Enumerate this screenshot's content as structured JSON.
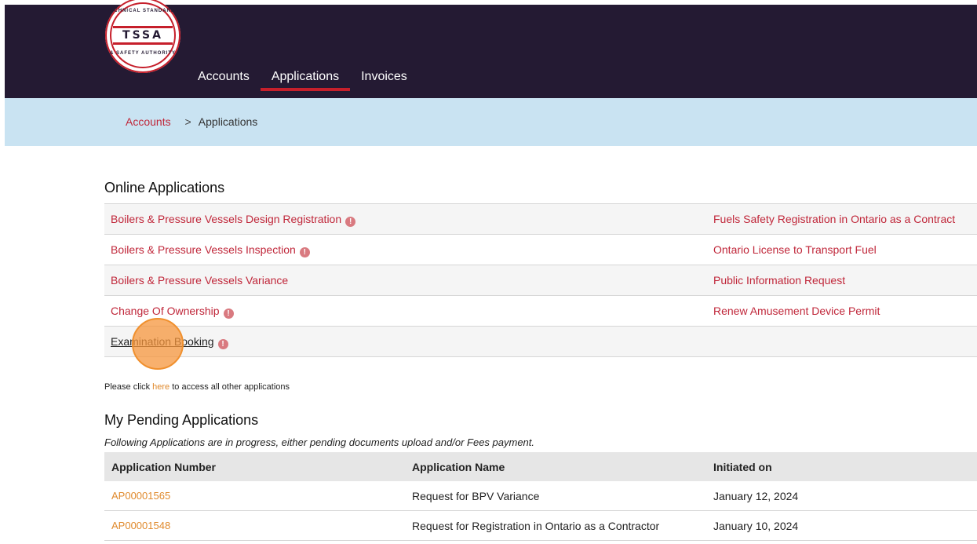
{
  "logo": {
    "center_text": "TSSA",
    "arc_top": "TECHNICAL STANDARDS",
    "arc_bottom": "& SAFETY AUTHORITY"
  },
  "nav": {
    "accounts": "Accounts",
    "applications": "Applications",
    "invoices": "Invoices",
    "active": "Applications"
  },
  "breadcrumb": {
    "root": "Accounts",
    "separator": ">",
    "current": "Applications"
  },
  "online": {
    "title": "Online Applications",
    "rows": [
      {
        "left": "Boilers & Pressure Vessels Design Registration",
        "left_info": true,
        "right": "Fuels Safety Registration in Ontario as a Contract"
      },
      {
        "left": "Boilers & Pressure Vessels Inspection",
        "left_info": true,
        "right": "Ontario License to Transport Fuel"
      },
      {
        "left": "Boilers & Pressure Vessels Variance",
        "left_info": false,
        "right": "Public Information Request"
      },
      {
        "left": "Change Of Ownership",
        "left_info": true,
        "right": "Renew Amusement Device Permit"
      },
      {
        "left": "Examination Booking",
        "left_info": true,
        "right": ""
      }
    ]
  },
  "other_apps": {
    "before": "Please click ",
    "link": "here",
    "after": " to access all other applications"
  },
  "pending": {
    "title": "My Pending Applications",
    "note": "Following Applications are in progress, either pending documents upload and/or Fees payment.",
    "headers": [
      "Application Number",
      "Application Name",
      "Initiated on"
    ],
    "rows": [
      [
        "AP00001565",
        "Request for BPV Variance",
        "January 12, 2024"
      ],
      [
        "AP00001548",
        "Request for Registration in Ontario as a Contractor",
        "January 10, 2024"
      ]
    ]
  },
  "colors": {
    "header_bg": "#241a33",
    "accent_red": "#c61f2b",
    "link_red": "#c0273a",
    "link_orange": "#e08a2d",
    "breadcrumb_bg": "#c9e3f2"
  }
}
